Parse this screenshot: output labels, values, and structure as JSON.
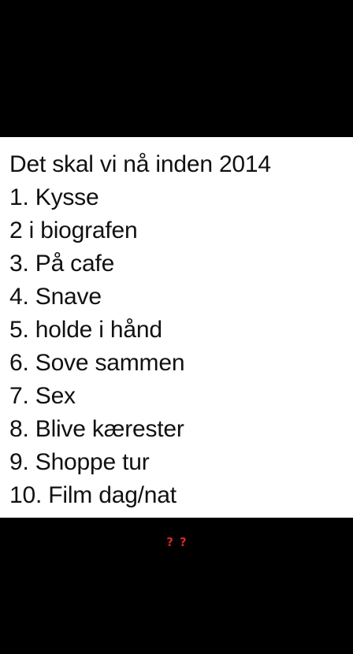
{
  "note": {
    "title": "Det skal vi nå inden 2014",
    "items": [
      "1. Kysse",
      "2 i biografen",
      "3. På cafe",
      "4. Snave",
      "5. holde i hånd",
      "6. Sove sammen",
      "7. Sex",
      "8. Blive kærester",
      "9. Shoppe tur",
      "10. Film dag/nat"
    ]
  },
  "reaction": {
    "text": "??",
    "color": "#d62828"
  },
  "colors": {
    "background": "#000000",
    "panel": "#ffffff",
    "text": "#111111"
  }
}
